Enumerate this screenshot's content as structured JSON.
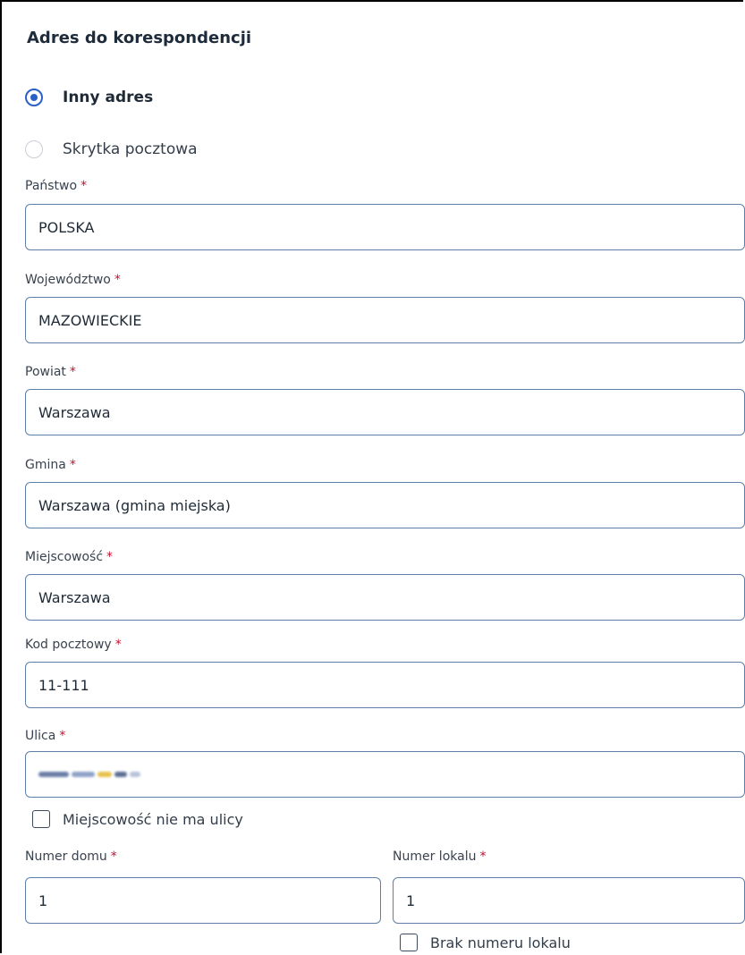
{
  "section": {
    "title": "Adres do korespondencji"
  },
  "address_type": {
    "options": [
      {
        "label": "Inny adres",
        "selected": true
      },
      {
        "label": "Skrytka pocztowa",
        "selected": false
      }
    ]
  },
  "required_marker": "*",
  "fields": {
    "country": {
      "label": "Państwo",
      "value": "POLSKA"
    },
    "voivodeship": {
      "label": "Województwo",
      "value": "MAZOWIECKIE"
    },
    "district": {
      "label": "Powiat",
      "value": "Warszawa"
    },
    "commune": {
      "label": "Gmina",
      "value": "Warszawa (gmina miejska)"
    },
    "locality": {
      "label": "Miejscowość",
      "value": "Warszawa"
    },
    "postal_code": {
      "label": "Kod pocztowy",
      "value": "11-111"
    },
    "street": {
      "label": "Ulica",
      "value": ""
    },
    "house_number": {
      "label": "Numer domu",
      "value": "1"
    },
    "apartment_number": {
      "label": "Numer lokalu",
      "value": "1"
    }
  },
  "checkboxes": {
    "no_street": {
      "label": "Miejscowość nie ma ulicy",
      "checked": false
    },
    "no_apartment": {
      "label": "Brak numeru lokalu",
      "checked": false
    }
  },
  "colors": {
    "accent": "#2b61c6",
    "required": "#c8102e",
    "input_border": "#5e7fa8"
  }
}
